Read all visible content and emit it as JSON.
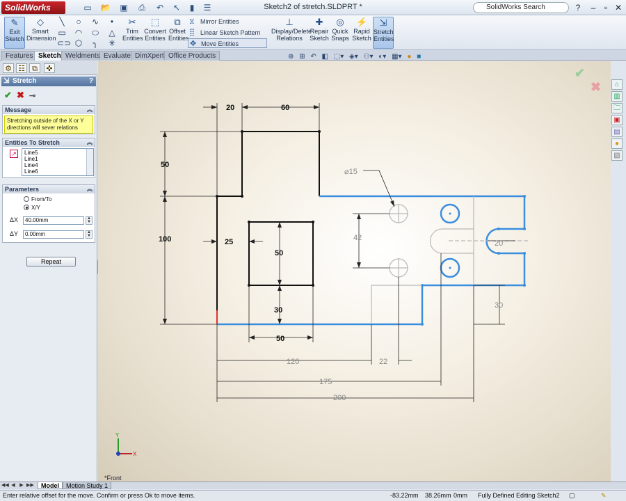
{
  "app": {
    "logo": "SolidWorks",
    "title": "Sketch2 of stretch.SLDPRT *",
    "search_placeholder": "SolidWorks Search"
  },
  "ribbon": {
    "exit_sketch": "Exit Sketch",
    "smart_dimension": "Smart Dimension",
    "trim_entities": "Trim Entities",
    "convert_entities": "Convert Entities",
    "offset_entities": "Offset Entities",
    "mirror_entities": "Mirror Entities",
    "linear_sketch_pattern": "Linear Sketch Pattern",
    "move_entities": "Move Entities",
    "display_delete_relations": "Display/Delete Relations",
    "repair_sketch": "Repair Sketch",
    "quick_snaps": "Quick Snaps",
    "rapid_sketch": "Rapid Sketch",
    "stretch_entities": "Stretch Entities"
  },
  "tabs": [
    "Features",
    "Sketch",
    "Weldments",
    "Evaluate",
    "DimXpert",
    "Office Products"
  ],
  "property_manager": {
    "title": "Stretch",
    "help": "?",
    "message_header": "Message",
    "message": "Stretching outside of the X or Y directions will sever relations",
    "entities_header": "Entities To Stretch",
    "entities": [
      "Line5",
      "Line1",
      "Line4",
      "Line6"
    ],
    "parameters_header": "Parameters",
    "radio_from_to": "From/To",
    "radio_xy": "X/Y",
    "dx_label": "ΔX",
    "dx_value": "40.00mm",
    "dy_label": "ΔY",
    "dy_value": "0.00mm",
    "repeat": "Repeat"
  },
  "dimensions": {
    "d20_top": "20",
    "d60": "60",
    "d50_left": "50",
    "d100": "100",
    "d25": "25",
    "d50_inner": "50",
    "d30_inner": "30",
    "d50_bottom": "50",
    "dia15": "⌀15",
    "d42": "42",
    "d20_right": "20",
    "d30_right": "30",
    "d120": "120",
    "d22": "22",
    "d175": "175",
    "d200": "200"
  },
  "view_label": "*Front",
  "bottom_tabs": [
    "Model",
    "Motion Study 1"
  ],
  "status": {
    "prompt": "Enter relative offset for the move. Confirm or press Ok to move items.",
    "x": "-83.22mm",
    "y": "38.26mm",
    "z": "0mm",
    "state": "Fully Defined",
    "editing": "Editing Sketch2"
  }
}
